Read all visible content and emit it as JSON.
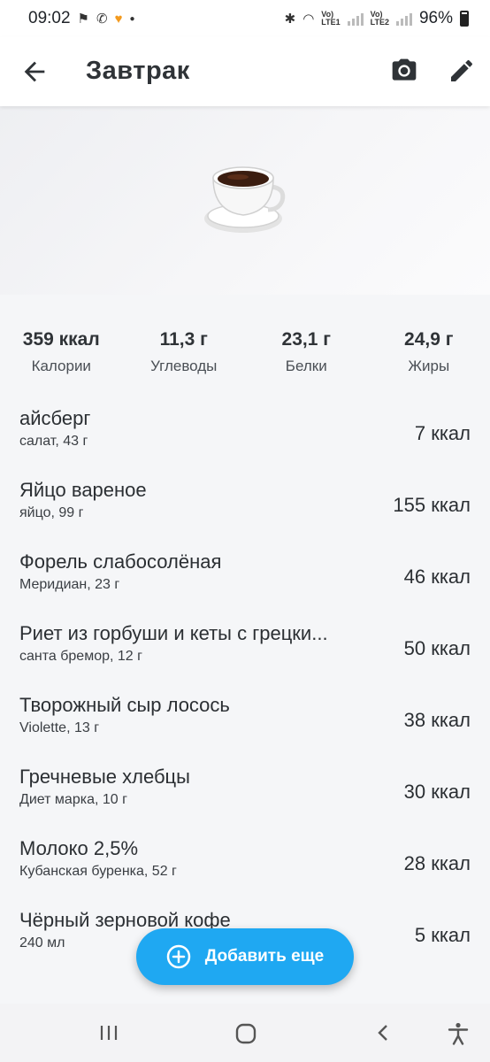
{
  "status_bar": {
    "time": "09:02",
    "battery": "96%",
    "lte1": "LTE1",
    "lte2": "LTE2",
    "volte": "Vo)"
  },
  "app_bar": {
    "title": "Завтрак"
  },
  "hero": {
    "icon": "coffee-cup-icon"
  },
  "macros": [
    {
      "value": "359 ккал",
      "label": "Калории"
    },
    {
      "value": "11,3 г",
      "label": "Углеводы"
    },
    {
      "value": "23,1 г",
      "label": "Белки"
    },
    {
      "value": "24,9 г",
      "label": "Жиры"
    }
  ],
  "foods": [
    {
      "name": "айсберг",
      "sub": "салат, 43 г",
      "kcal": "7 ккал"
    },
    {
      "name": "Яйцо вареное",
      "sub": "яйцо, 99 г",
      "kcal": "155 ккал"
    },
    {
      "name": "Форель слабосолёная",
      "sub": "Меридиан, 23 г",
      "kcal": "46 ккал"
    },
    {
      "name": "Риет из горбуши и кеты с грецки...",
      "sub": "санта бремор, 12 г",
      "kcal": "50 ккал"
    },
    {
      "name": "Творожный сыр лосось",
      "sub": "Violette, 13 г",
      "kcal": "38 ккал"
    },
    {
      "name": "Гречневые хлебцы",
      "sub": "Диет марка, 10 г",
      "kcal": "30 ккал"
    },
    {
      "name": "Молоко 2,5%",
      "sub": "Кубанская буренка, 52 г",
      "kcal": "28 ккал"
    },
    {
      "name": "Чёрный зерновой кофе",
      "sub": "240 мл",
      "kcal": "5 ккал"
    }
  ],
  "fab": {
    "label": "Добавить еще"
  },
  "colors": {
    "accent": "#1fa8f2",
    "text": "#2b2f33",
    "background": "#f5f6f8"
  }
}
